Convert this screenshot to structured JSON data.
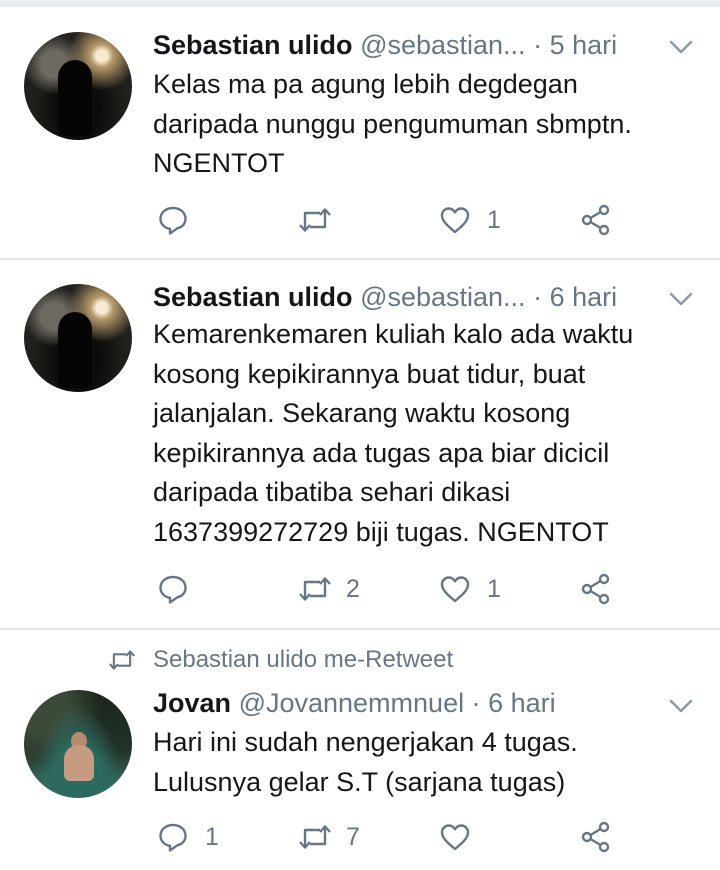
{
  "tweets": [
    {
      "name": "Sebastian ulido",
      "handle": "@sebastian...",
      "dot": "·",
      "time": "5 hari",
      "lines": [
        "Kelas ma pa agung lebih degdegan",
        "daripada nunggu pengumuman sbmptn.",
        "NGENTOT"
      ],
      "reply_count": "",
      "retweet_count": "",
      "like_count": "1"
    },
    {
      "name": "Sebastian ulido",
      "handle": "@sebastian...",
      "dot": "·",
      "time": "6 hari",
      "lines": [
        "Kemarenkemaren kuliah kalo ada waktu",
        "kosong kepikirannya buat tidur, buat",
        "jalanjalan. Sekarang waktu kosong",
        "kepikirannya ada tugas apa biar dicicil",
        "daripada tibatiba sehari dikasi",
        "1637399272729 biji tugas. NGENTOT"
      ],
      "reply_count": "",
      "retweet_count": "2",
      "like_count": "1"
    },
    {
      "retweet_context": "Sebastian ulido me-Retweet",
      "name": "Jovan",
      "handle": "@Jovannemmnuel",
      "dot": "·",
      "time": "6 hari",
      "lines": [
        "Hari ini sudah nengerjakan 4 tugas.",
        "Lulusnya gelar S.T (sarjana tugas)"
      ],
      "reply_count": "1",
      "retweet_count": "7",
      "like_count": ""
    }
  ],
  "icons": {
    "reply": "reply-icon",
    "retweet": "retweet-icon",
    "like": "heart-icon",
    "share": "share-icon",
    "caret": "chevron-down-icon"
  },
  "colors": {
    "text": "#14171a",
    "secondary": "#657786",
    "divider": "#e1e8ed",
    "icon": "#657786"
  }
}
